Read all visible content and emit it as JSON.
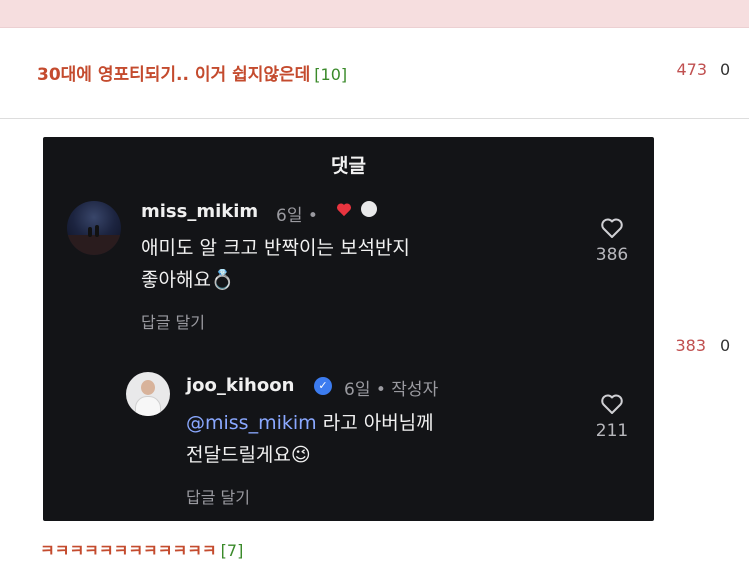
{
  "post": {
    "title": "30대에 영포티되기.. 이거 쉽지않은데",
    "comment_count": "[10]",
    "views": "473",
    "likes": "0"
  },
  "side_stats": {
    "views": "383",
    "likes": "0"
  },
  "screenshot": {
    "header": "댓글",
    "comment1": {
      "username": "miss_mikim",
      "meta": "6일 •",
      "line1": "애미도 알 크고 반짝이는 보석반지",
      "line2": "좋아해요💍",
      "reply_label": "답글 달기",
      "heart_count": "386"
    },
    "comment2": {
      "username": "joo_kihoon",
      "meta": "6일 • 작성자",
      "mention": "@miss_mikim",
      "line1_rest": " 라고 아버님께",
      "line2": "전달드릴게요😉",
      "reply_label": "답글 달기",
      "heart_count": "211"
    }
  },
  "next_post": {
    "title": "ㅋㅋㅋㅋㅋㅋㅋㅋㅋㅋㅋㅋ",
    "comment_count": "[7]"
  },
  "colors": {
    "title_red": "#c44b2e",
    "comment_green": "#3a8a2a",
    "views_red": "#c05050",
    "topbar_pink": "#f6dedf"
  }
}
